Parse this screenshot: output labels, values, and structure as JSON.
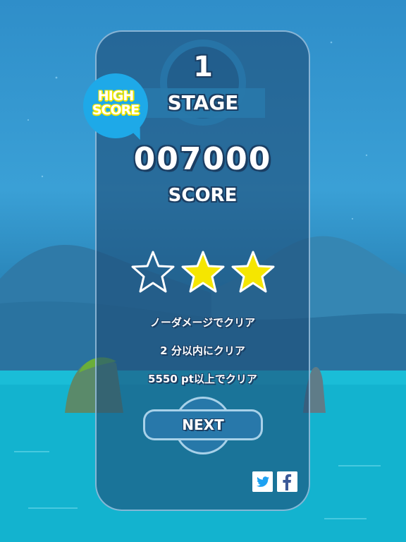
{
  "stage": {
    "number": "1",
    "label": "STAGE"
  },
  "high_score_badge": {
    "line1": "HIGH",
    "line2": "SCORE"
  },
  "score": {
    "value": "007000",
    "label": "SCORE"
  },
  "stars": {
    "earned": 2,
    "total": 3,
    "filled_color": "#f5e600",
    "empty_color": "#ffffff"
  },
  "conditions": [
    {
      "text": "ノーダメージでクリア"
    },
    {
      "text": "2 分以内にクリア"
    },
    {
      "text": "5550 pt以上でクリア"
    }
  ],
  "next_button": {
    "label": "NEXT"
  },
  "share": {
    "twitter_icon": "twitter-icon",
    "facebook_icon": "facebook-icon"
  },
  "colors": {
    "panel": "#1e4e78",
    "accent": "#2878aa",
    "bubble": "#1ea9e8",
    "twitter": "#1da1f2",
    "facebook": "#3b5998"
  }
}
